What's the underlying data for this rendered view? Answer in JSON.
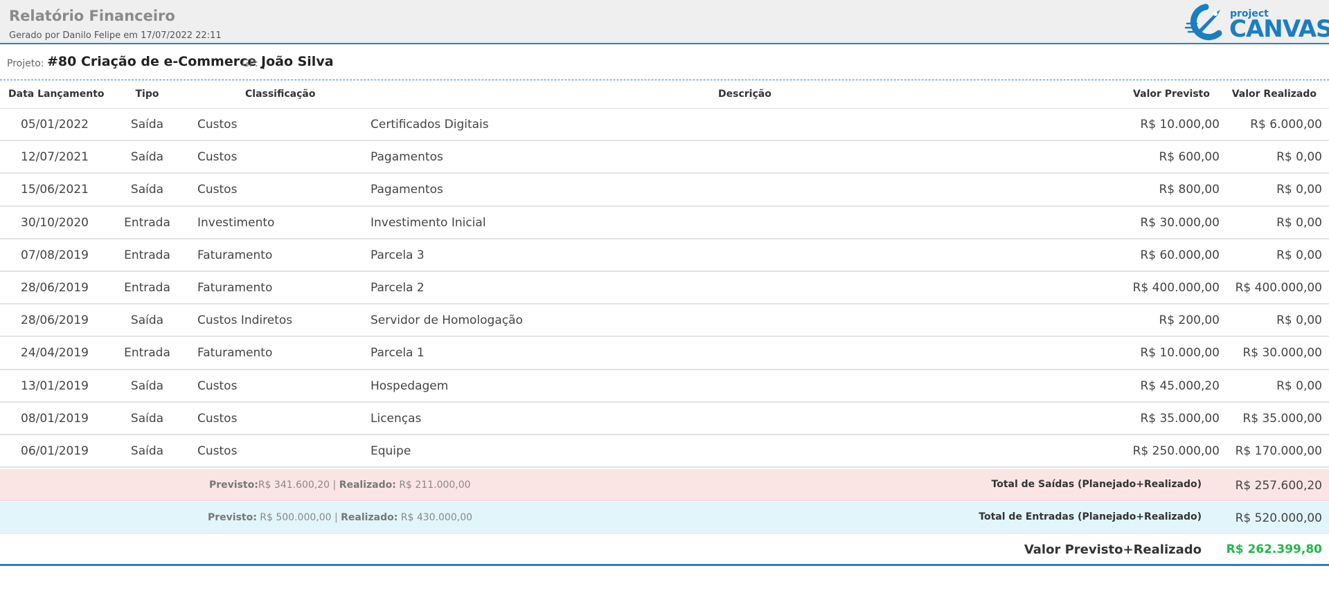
{
  "header": {
    "title": "Relatório Financeiro",
    "subtitle": "Gerado por Danilo Felipe em 17/07/2022 22:11",
    "logo_small": "project",
    "logo_big": "CANVAS"
  },
  "project": {
    "label": "Projeto:",
    "value": "#80 Criação de e-Commerce |",
    "gp_label": "GP:",
    "gp_value": "João Silva"
  },
  "columns": [
    "Data Lançamento",
    "Tipo",
    "Classificação",
    "Descrição",
    "Valor Previsto",
    "Valor Realizado"
  ],
  "rows": [
    {
      "date": "05/01/2022",
      "tipo": "Saída",
      "classificacao": "Custos",
      "descricao": "Certificados Digitais",
      "previsto": "R$ 10.000,00",
      "realizado": "R$ 6.000,00"
    },
    {
      "date": "12/07/2021",
      "tipo": "Saída",
      "classificacao": "Custos",
      "descricao": "Pagamentos",
      "previsto": "R$ 600,00",
      "realizado": "R$ 0,00"
    },
    {
      "date": "15/06/2021",
      "tipo": "Saída",
      "classificacao": "Custos",
      "descricao": "Pagamentos",
      "previsto": "R$ 800,00",
      "realizado": "R$ 0,00"
    },
    {
      "date": "30/10/2020",
      "tipo": "Entrada",
      "classificacao": "Investimento",
      "descricao": "Investimento Inicial",
      "previsto": "R$ 30.000,00",
      "realizado": "R$ 0,00"
    },
    {
      "date": "07/08/2019",
      "tipo": "Entrada",
      "classificacao": "Faturamento",
      "descricao": "Parcela 3",
      "previsto": "R$ 60.000,00",
      "realizado": "R$ 0,00"
    },
    {
      "date": "28/06/2019",
      "tipo": "Entrada",
      "classificacao": "Faturamento",
      "descricao": "Parcela 2",
      "previsto": "R$ 400.000,00",
      "realizado": "R$ 400.000,00"
    },
    {
      "date": "28/06/2019",
      "tipo": "Saída",
      "classificacao": "Custos Indiretos",
      "descricao": "Servidor de Homologação",
      "previsto": "R$ 200,00",
      "realizado": "R$ 0,00"
    },
    {
      "date": "24/04/2019",
      "tipo": "Entrada",
      "classificacao": "Faturamento",
      "descricao": "Parcela 1",
      "previsto": "R$ 10.000,00",
      "realizado": "R$ 30.000,00"
    },
    {
      "date": "13/01/2019",
      "tipo": "Saída",
      "classificacao": "Custos",
      "descricao": "Hospedagem",
      "previsto": "R$ 45.000,20",
      "realizado": "R$ 0,00"
    },
    {
      "date": "08/01/2019",
      "tipo": "Saída",
      "classificacao": "Custos",
      "descricao": "Licenças",
      "previsto": "R$ 35.000,00",
      "realizado": "R$ 35.000,00"
    },
    {
      "date": "06/01/2019",
      "tipo": "Saída",
      "classificacao": "Custos",
      "descricao": "Equipe",
      "previsto": "R$ 250.000,00",
      "realizado": "R$ 170.000,00"
    }
  ],
  "totals": {
    "saidas": {
      "previsto_label": "Previsto:",
      "previsto_value": "R$ 341.600,20",
      "sep": "|",
      "realizado_label": "Realizado:",
      "realizado_value": "R$ 211.000,00",
      "label": "Total de Saídas (Planejado+Realizado)",
      "amount": "R$ 257.600,20"
    },
    "entradas": {
      "previsto_label": "Previsto:",
      "previsto_value": "R$ 500.000,00",
      "sep": "|",
      "realizado_label": "Realizado:",
      "realizado_value": "R$ 430.000,00",
      "label": "Total de Entradas (Planejado+Realizado)",
      "amount": "R$ 520.000,00"
    },
    "grand": {
      "label": "Valor Previsto+Realizado",
      "amount": "R$ 262.399,80"
    }
  },
  "colors": {
    "accent": "#2f7fc1",
    "saidas_bg": "#fbe5e4",
    "entradas_bg": "#e2f5fa",
    "grand_total": "#1fb84b"
  }
}
